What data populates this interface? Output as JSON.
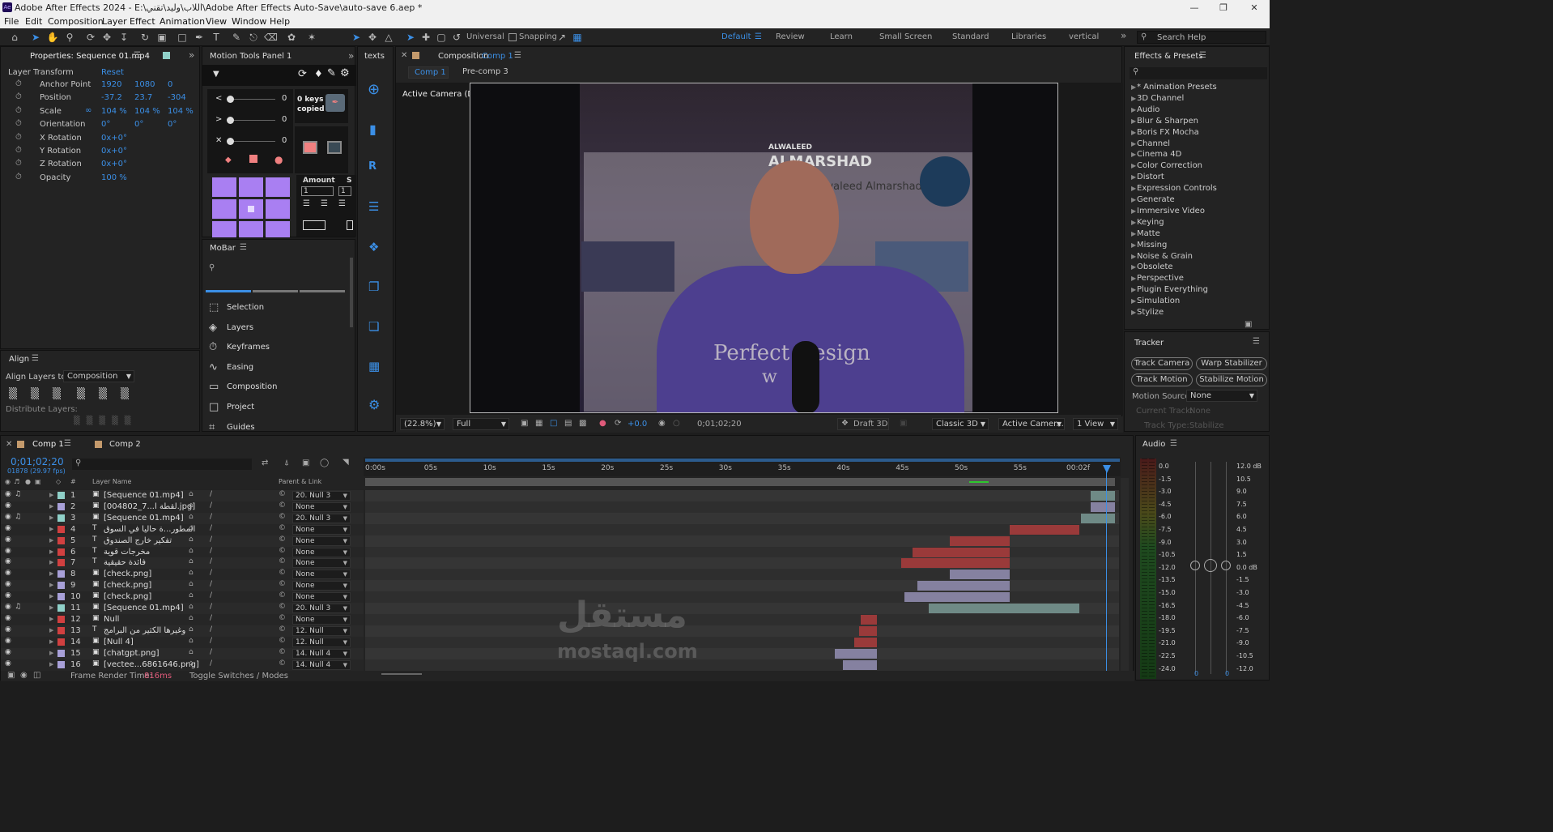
{
  "app": {
    "title": "Adobe After Effects 2024 - E:\\اللاب\\وليد\\تقني\\Adobe After Effects Auto-Save\\auto-save 6.aep *",
    "logo": "Ae"
  },
  "menu": [
    "File",
    "Edit",
    "Composition",
    "Layer",
    "Effect",
    "Animation",
    "View",
    "Window",
    "Help"
  ],
  "toolbar": {
    "universal": "Universal",
    "snapping": "Snapping",
    "workspaces": [
      "Default",
      "Review",
      "Learn",
      "Small Screen",
      "Standard",
      "Libraries",
      "vertical"
    ],
    "search_placeholder": "Search Help"
  },
  "properties": {
    "tab": "Properties: Sequence 01.mp4",
    "section": "Layer Transform",
    "reset": "Reset",
    "rows": [
      {
        "label": "Anchor Point",
        "v": [
          "1920",
          "1080",
          "0"
        ]
      },
      {
        "label": "Position",
        "v": [
          "-37.2",
          "23.7",
          "-304"
        ]
      },
      {
        "label": "Scale",
        "v": [
          "104 %",
          "104 %",
          "104 %"
        ]
      },
      {
        "label": "Orientation",
        "v": [
          "0°",
          "0°",
          "0°"
        ]
      },
      {
        "label": "X Rotation",
        "v": [
          "0x+0°"
        ]
      },
      {
        "label": "Y Rotation",
        "v": [
          "0x+0°"
        ]
      },
      {
        "label": "Z Rotation",
        "v": [
          "0x+0°"
        ]
      },
      {
        "label": "Opacity",
        "v": [
          "100 %"
        ]
      }
    ]
  },
  "motion_tools": {
    "tab": "Motion Tools Panel 1",
    "vals": [
      "0",
      "0",
      "0"
    ],
    "keys": "0 keys",
    "copied": "copied",
    "amount": "Amount",
    "amount_vals": [
      "1",
      "1"
    ],
    "s": "S"
  },
  "texts_tab": "texts",
  "mobar": {
    "tab": "MoBar",
    "items": [
      "Selection",
      "Layers",
      "Keyframes",
      "Easing",
      "Composition",
      "Project",
      "Guides"
    ]
  },
  "align": {
    "tab": "Align",
    "align_to_label": "Align Layers to:",
    "align_to": "Composition",
    "distribute": "Distribute Layers:"
  },
  "composition": {
    "tab": "Composition",
    "tab_name": "Comp 1",
    "sub_tabs": [
      "Comp 1",
      "Pre-comp 3"
    ],
    "camera": "Active Camera (Default)",
    "video_text": {
      "brand1": "ALWALEED",
      "brand2": "ALMARSHAD",
      "channel": "Alwaleed Almarshad",
      "hoodie1": "Perfect Design",
      "hoodie2": "w"
    },
    "footer": {
      "zoom": "(22.8%)",
      "res": "Full",
      "exposure": "+0.0",
      "time": "0;01;02;20",
      "draft": "Draft 3D",
      "renderer": "Classic 3D",
      "camera": "Active Camer...",
      "view": "1 View"
    }
  },
  "effects": {
    "tab": "Effects & Presets",
    "items": [
      "* Animation Presets",
      "3D Channel",
      "Audio",
      "Blur & Sharpen",
      "Boris FX Mocha",
      "Channel",
      "Cinema 4D",
      "Color Correction",
      "Distort",
      "Expression Controls",
      "Generate",
      "Immersive Video",
      "Keying",
      "Matte",
      "Missing",
      "Noise & Grain",
      "Obsolete",
      "Perspective",
      "Plugin Everything",
      "Simulation",
      "Stylize"
    ]
  },
  "tracker": {
    "tab": "Tracker",
    "buttons": [
      "Track Camera",
      "Warp Stabilizer",
      "Track Motion",
      "Stabilize Motion"
    ],
    "motion_source_label": "Motion Source:",
    "motion_source": "None",
    "current_track_label": "Current Track:",
    "current_track": "None",
    "track_type_label": "Track Type:",
    "track_type": "Stabilize"
  },
  "timeline": {
    "tabs": [
      "Comp 1",
      "Comp 2"
    ],
    "timecode": "0;01;02;20",
    "frames": "01878 (29.97 fps)",
    "col_layer": "Layer Name",
    "col_parent": "Parent & Link",
    "ruler": [
      "0:00s",
      "05s",
      "10s",
      "15s",
      "20s",
      "25s",
      "30s",
      "35s",
      "40s",
      "45s",
      "50s",
      "55s",
      "00:02f"
    ],
    "layers": [
      {
        "n": "1",
        "name": "[Sequence 01.mp4]",
        "parent": "20. Null 3",
        "color": "#8fd0c8"
      },
      {
        "n": "2",
        "name": "[004802_7...لقطة ا.jpg]",
        "parent": "None",
        "color": "#a8a0d8"
      },
      {
        "n": "3",
        "name": "[Sequence 01.mp4]",
        "parent": "20. Null 3",
        "color": "#8fd0c8"
      },
      {
        "n": "4",
        "name": "المطور...ة حاليا في السوق",
        "parent": "None",
        "color": "#d14040"
      },
      {
        "n": "5",
        "name": "تفكير خارج الصندوق",
        "parent": "None",
        "color": "#d14040"
      },
      {
        "n": "6",
        "name": "مخرجات قوية",
        "parent": "None",
        "color": "#d14040"
      },
      {
        "n": "7",
        "name": "فائدة حقيقية",
        "parent": "None",
        "color": "#d14040"
      },
      {
        "n": "8",
        "name": "[check.png]",
        "parent": "None",
        "color": "#a8a0d8"
      },
      {
        "n": "9",
        "name": "[check.png]",
        "parent": "None",
        "color": "#a8a0d8"
      },
      {
        "n": "10",
        "name": "[check.png]",
        "parent": "None",
        "color": "#a8a0d8"
      },
      {
        "n": "11",
        "name": "[Sequence 01.mp4]",
        "parent": "20. Null 3",
        "color": "#8fd0c8"
      },
      {
        "n": "12",
        "name": "Null",
        "parent": "None",
        "color": "#d14040"
      },
      {
        "n": "13",
        "name": "وغيرها الكثير من البرامج",
        "parent": "12. Null",
        "color": "#d14040"
      },
      {
        "n": "14",
        "name": "[Null 4]",
        "parent": "12. Null",
        "color": "#d14040"
      },
      {
        "n": "15",
        "name": "[chatgpt.png]",
        "parent": "14. Null 4",
        "color": "#a8a0d8"
      },
      {
        "n": "16",
        "name": "[vectee...6861646.png]",
        "parent": "14. Null 4",
        "color": "#a8a0d8"
      }
    ],
    "footer_label": "Frame Render Time:",
    "render_time": "816ms",
    "toggle": "Toggle Switches / Modes"
  },
  "audio": {
    "tab": "Audio",
    "left_scale": [
      "0.0",
      "-1.5",
      "-3.0",
      "-4.5",
      "-6.0",
      "-7.5",
      "-9.0",
      "-10.5",
      "-12.0",
      "-13.5",
      "-15.0",
      "-16.5",
      "-18.0",
      "-19.5",
      "-21.0",
      "-22.5",
      "-24.0"
    ],
    "right_scale": [
      "12.0 dB",
      "10.5",
      "9.0",
      "7.5",
      "6.0",
      "4.5",
      "3.0",
      "1.5",
      "0.0 dB",
      "-1.5",
      "-3.0",
      "-4.5",
      "-6.0",
      "-7.5",
      "-9.0",
      "-10.5",
      "-12.0"
    ],
    "bottom": [
      "0",
      "0"
    ]
  },
  "watermark": {
    "ar": "مستقل",
    "en": "mostaql.com"
  }
}
